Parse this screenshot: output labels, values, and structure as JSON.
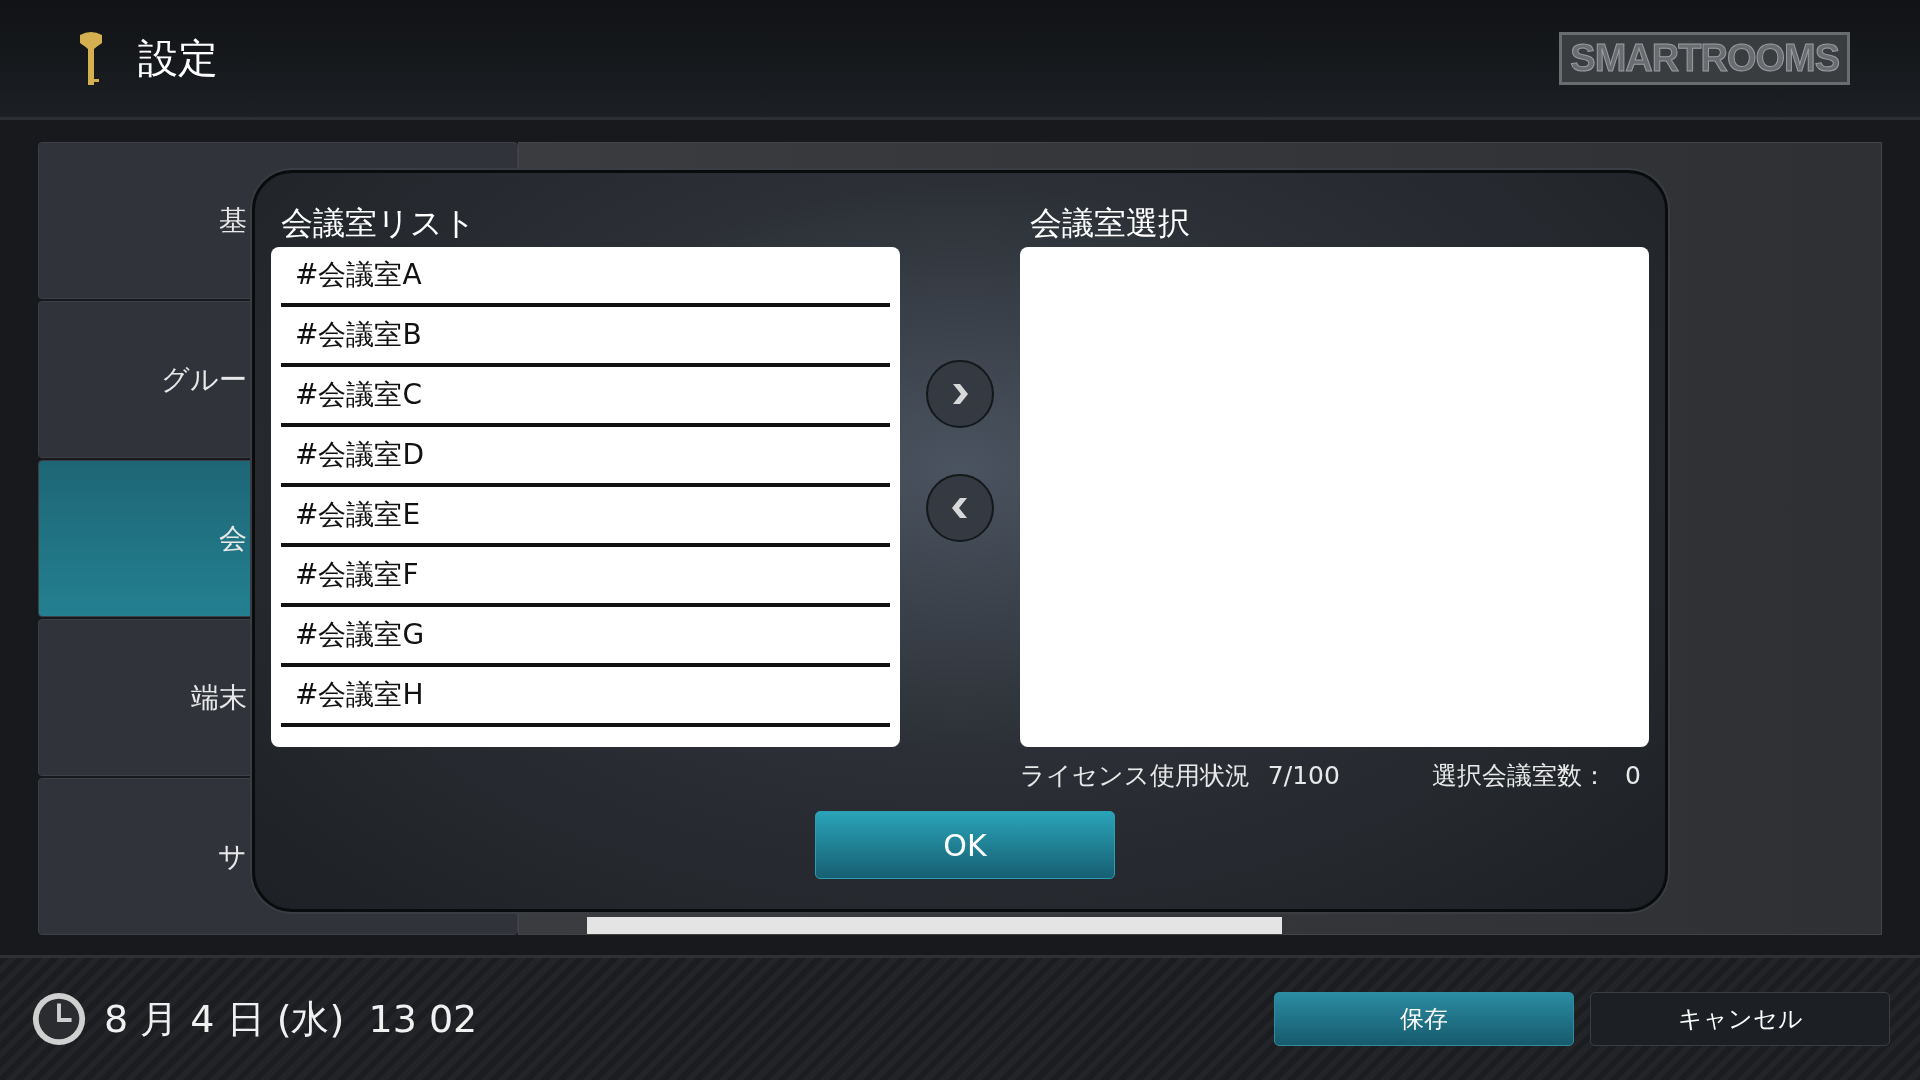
{
  "header": {
    "title": "設定",
    "logo": "SMARTROOMS"
  },
  "sidebar": {
    "items": [
      {
        "label": "基",
        "selected": false
      },
      {
        "label": "グルー",
        "selected": false
      },
      {
        "label": "会",
        "selected": true
      },
      {
        "label": "端末",
        "selected": false
      },
      {
        "label": "サ",
        "selected": false
      }
    ]
  },
  "dialog": {
    "list_title": "会議室リスト",
    "rooms": [
      {
        "label": "#会議室A"
      },
      {
        "label": "#会議室B"
      },
      {
        "label": "#会議室C"
      },
      {
        "label": "#会議室D"
      },
      {
        "label": "#会議室E"
      },
      {
        "label": "#会議室F"
      },
      {
        "label": "#会議室G"
      },
      {
        "label": "#会議室H"
      }
    ],
    "selection_title": "会議室選択",
    "license_label": "ライセンス使用状況",
    "license_value": "7/100",
    "count_label": "選択会議室数：",
    "count_value": "0",
    "ok_button": "OK"
  },
  "status_bar": {
    "datetime": "8 月 4 日 (水)  13 02",
    "save_button": "保存",
    "cancel_button": "キャンセル"
  }
}
